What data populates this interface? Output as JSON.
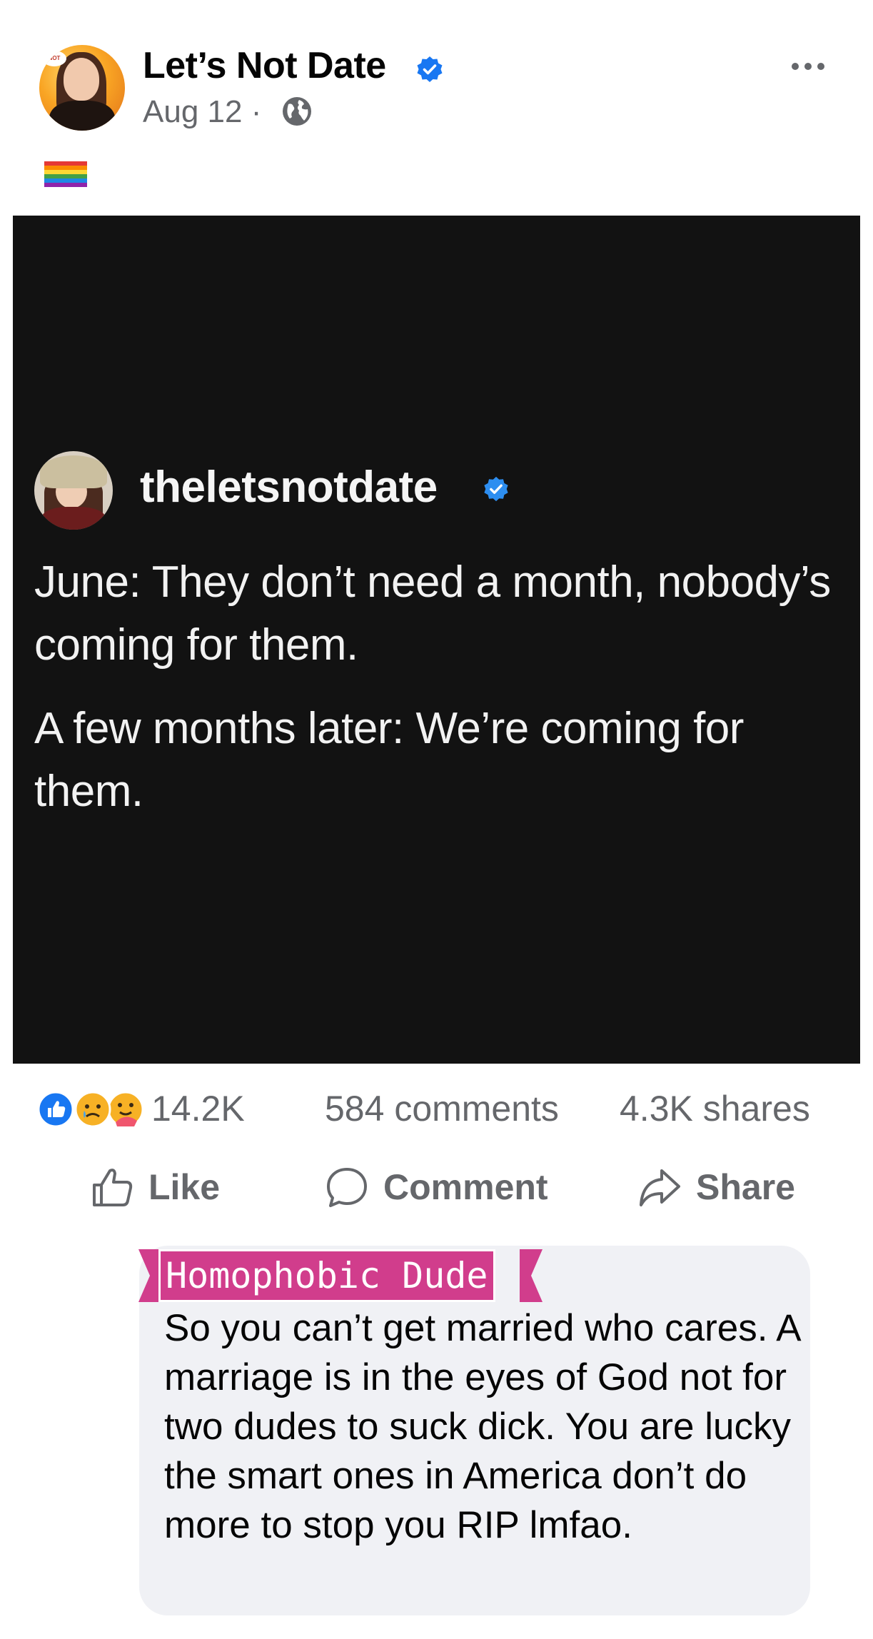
{
  "post": {
    "page_name": "Let’s Not Date",
    "date": "Aug 12",
    "separator": "·",
    "caption_emoji": "rainbow-flag",
    "avatar_badge": "NOT"
  },
  "media": {
    "handle": "theletsnotdate",
    "paragraph_1": "June: They don’t need a month, nobody’s coming for them.",
    "paragraph_2": "A few months later: We’re coming for them."
  },
  "stats": {
    "reactions": [
      "like",
      "sad",
      "care"
    ],
    "reaction_count": "14.2K",
    "comments": "584 comments",
    "shares": "4.3K shares"
  },
  "actions": {
    "like": "Like",
    "comment": "Comment",
    "share": "Share"
  },
  "comment": {
    "author": "Homophobic Dude",
    "text": "So you can’t get married who cares. A marriage is in the eyes of God not for two dudes to suck dick. You are lucky the smart ones in  America don’t do more to stop you RIP lmfao."
  },
  "colors": {
    "verified_blue": "#1877f2",
    "media_bg": "#121212",
    "secondary_text": "#65676b",
    "comment_bg": "#f0f1f5",
    "author_tag": "#d13d8c"
  }
}
